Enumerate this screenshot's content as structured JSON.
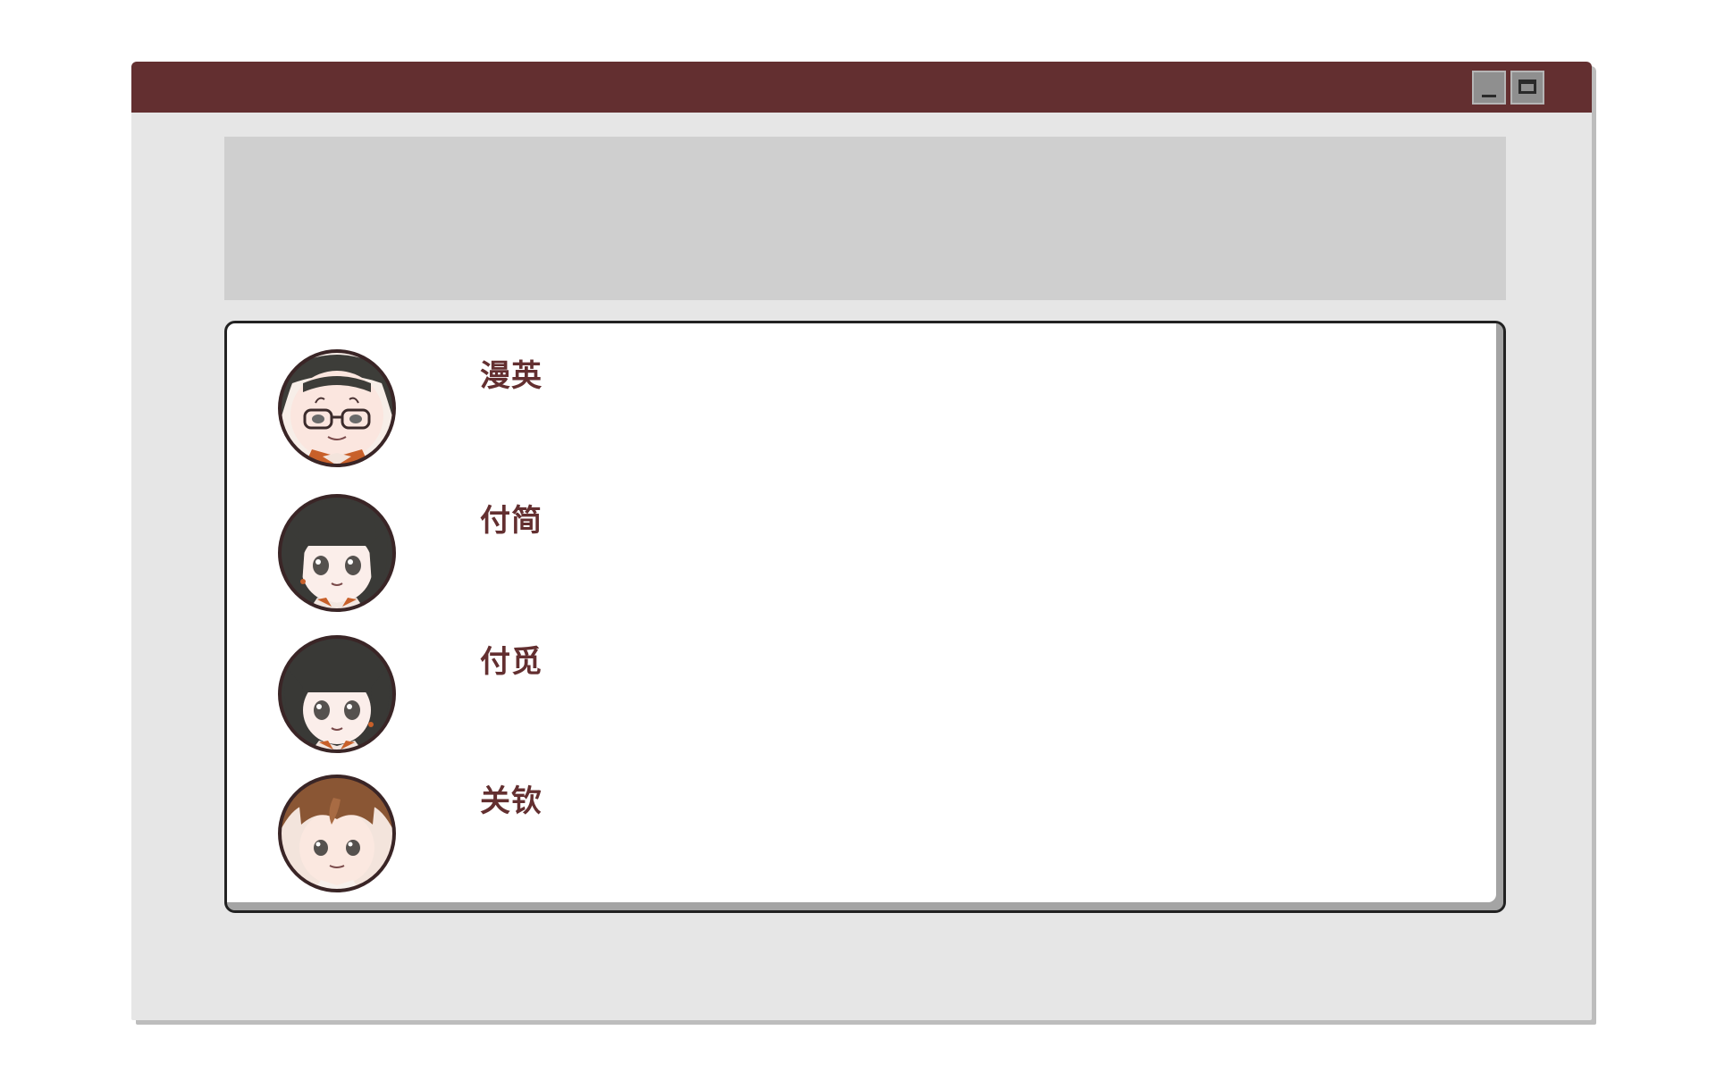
{
  "colors": {
    "titlebar": "#632f30",
    "window_bg": "#e6e6e6",
    "header_panel": "#cfcfcf",
    "list_bg": "#ffffff",
    "name_text": "#632f30"
  },
  "titlebar": {
    "buttons": [
      {
        "icon": "minimize-icon"
      },
      {
        "icon": "maximize-icon"
      }
    ]
  },
  "contacts": [
    {
      "name": "漫英",
      "avatar": "elderly-man-glasses-avatar"
    },
    {
      "name": "付简",
      "avatar": "girl-bob-hair-avatar"
    },
    {
      "name": "付觅",
      "avatar": "girl-bangs-avatar"
    },
    {
      "name": "关钦",
      "avatar": "young-man-brown-hair-avatar"
    }
  ]
}
